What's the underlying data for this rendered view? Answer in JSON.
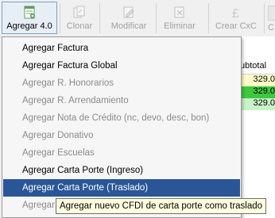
{
  "toolbar": {
    "buttons": [
      {
        "label": "Agregar 4.0",
        "icon": "add-document-icon"
      },
      {
        "label": "Clonar",
        "icon": "clone-icon"
      },
      {
        "label": "Modificar",
        "icon": "edit-icon"
      },
      {
        "label": "Eliminar",
        "icon": "delete-icon"
      },
      {
        "label": "Crear CxC",
        "icon": "pound-icon"
      },
      {
        "label": "C",
        "icon": "partial-icon"
      }
    ]
  },
  "grid": {
    "header": "ubtotal",
    "rows": [
      {
        "value": "329.0",
        "color": "#ffffc8"
      },
      {
        "value": "329.0",
        "color": "#3ec83e"
      },
      {
        "value": "329.0",
        "color": "#c8f2c8"
      }
    ]
  },
  "menu": {
    "items": [
      {
        "label": "Agregar Factura",
        "enabled": true
      },
      {
        "label": "Agregar Factura Global",
        "enabled": true
      },
      {
        "label": "Agregar R. Honorarios",
        "enabled": false
      },
      {
        "label": "Agregar R. Arrendamiento",
        "enabled": false
      },
      {
        "label": "Agregar Nota de Crédito (nc, devo, desc, bon)",
        "enabled": false
      },
      {
        "label": "Agregar Donativo",
        "enabled": false
      },
      {
        "label": "Agregar Escuelas",
        "enabled": false
      },
      {
        "label": "Agregar Carta Porte (Ingreso)",
        "enabled": true
      },
      {
        "label": "Agregar Carta Porte (Traslado)",
        "enabled": true,
        "selected": true
      },
      {
        "label": "Agregar",
        "enabled": false
      }
    ]
  },
  "tooltip": "Agregar nuevo CFDI de carta porte como traslado",
  "colors": {
    "selection": "#2a5697",
    "tooltip_bg": "#ffffe1"
  }
}
